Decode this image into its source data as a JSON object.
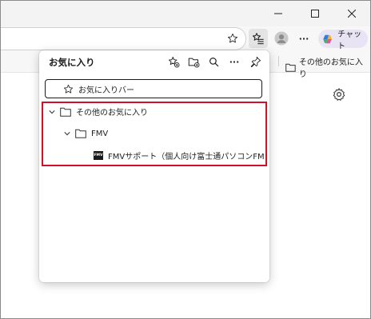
{
  "window_controls": {
    "minimize": "minimize",
    "maximize": "maximize",
    "close": "close"
  },
  "toolbar": {
    "copilot_label": "チャット",
    "more_label": "···"
  },
  "favorites_bar": {
    "folder_label": "その他のお気に入り"
  },
  "panel": {
    "title": "お気に入り",
    "actions": [
      "add-favorite-icon",
      "add-folder-icon",
      "search-icon",
      "more-icon",
      "pin-icon"
    ],
    "tree": {
      "favorites_bar_label": "お気に入りバー",
      "other_favorites_label": "その他のお気に入り",
      "fmv_folder_label": "FMV",
      "fmv_link_label": "FMVサポート（個人向け富士通パソコンFM",
      "fmv_logo_text": "FMV"
    }
  },
  "colors": {
    "highlight": "#d0112b",
    "copilot_bg": "#e8e4f4",
    "titlebar": "#f3f3f3"
  }
}
